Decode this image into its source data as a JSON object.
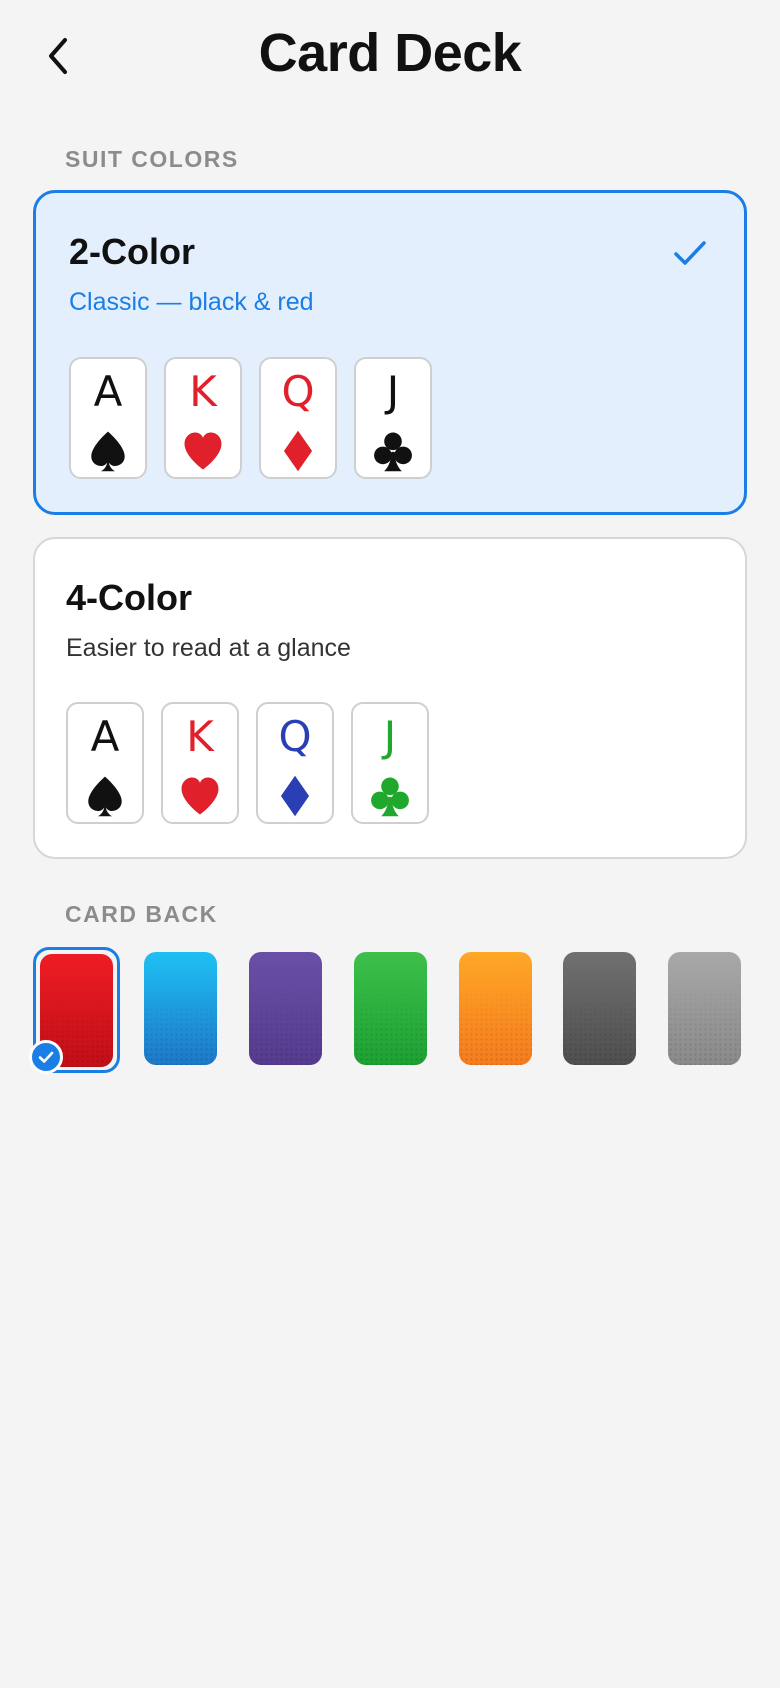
{
  "header": {
    "title": "Card Deck",
    "back_icon": "chevron-left-icon"
  },
  "sections": {
    "suit_colors": "SUIT COLORS",
    "card_back": "CARD BACK"
  },
  "colors": {
    "accent": "#1a7ee6",
    "selected_bg": "#e3effd",
    "red": "#e0202b",
    "black": "#111111",
    "blue": "#2b3fb5",
    "green": "#1fa82b"
  },
  "options": [
    {
      "title": "2-Color",
      "subtitle": "Classic — black & red",
      "selected": true,
      "cards": [
        {
          "rank": "A",
          "suit": "spade",
          "color": "#111111"
        },
        {
          "rank": "K",
          "suit": "heart",
          "color": "#e0202b"
        },
        {
          "rank": "Q",
          "suit": "diamond",
          "color": "#e0202b"
        },
        {
          "rank": "J",
          "suit": "club",
          "color": "#111111"
        }
      ]
    },
    {
      "title": "4-Color",
      "subtitle": "Easier to read at a glance",
      "selected": false,
      "cards": [
        {
          "rank": "A",
          "suit": "spade",
          "color": "#111111"
        },
        {
          "rank": "K",
          "suit": "heart",
          "color": "#e0202b"
        },
        {
          "rank": "Q",
          "suit": "diamond",
          "color": "#2b3fb5"
        },
        {
          "rank": "J",
          "suit": "club",
          "color": "#1fa82b"
        }
      ]
    }
  ],
  "card_backs": [
    {
      "name": "red",
      "top": "#ee1c24",
      "bottom": "#c20f17",
      "selected": true
    },
    {
      "name": "blue",
      "top": "#1ec0f3",
      "bottom": "#1f78c8",
      "selected": false
    },
    {
      "name": "purple",
      "top": "#6a4fa6",
      "bottom": "#563c8f",
      "selected": false
    },
    {
      "name": "green",
      "top": "#3cc04a",
      "bottom": "#1ea133",
      "selected": false
    },
    {
      "name": "orange",
      "top": "#ffa726",
      "bottom": "#f57c1f",
      "selected": false
    },
    {
      "name": "dark-gray",
      "top": "#707070",
      "bottom": "#4f4f4f",
      "selected": false
    },
    {
      "name": "light-gray",
      "top": "#a8a8a8",
      "bottom": "#8a8a8a",
      "selected": false
    }
  ]
}
